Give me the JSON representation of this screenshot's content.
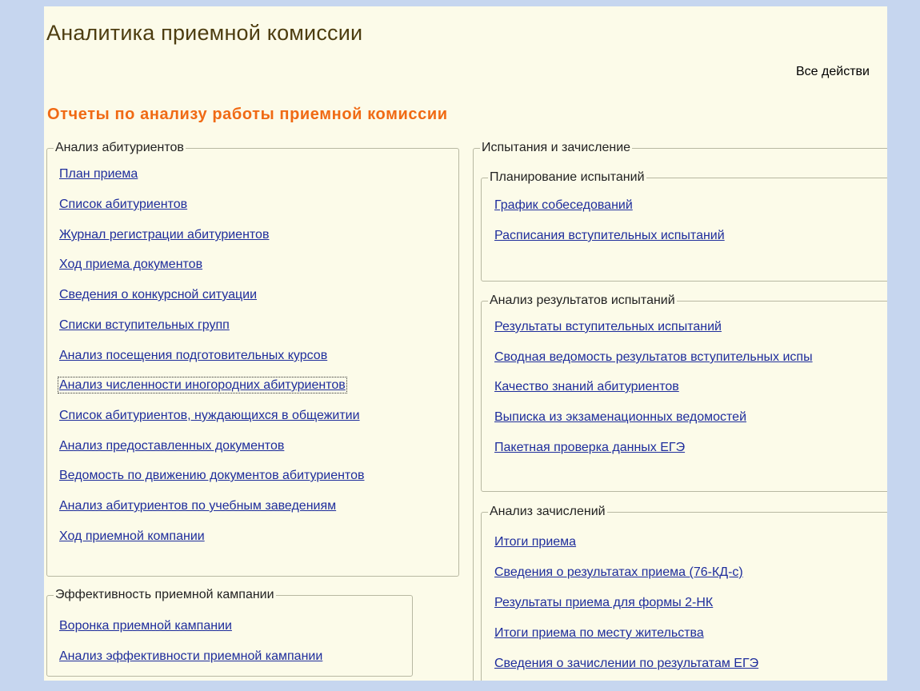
{
  "header": {
    "title": "Аналитика приемной комиссии",
    "all_actions": "Все действи"
  },
  "section_title": "Отчеты по анализу работы приемной комиссии",
  "groups": {
    "applicants": {
      "title": "Анализ абитуриентов",
      "links": [
        "План приема",
        "Список абитуриентов",
        "Журнал регистрации абитуриентов",
        "Ход приема документов",
        "Сведения о конкурсной ситуации",
        "Списки вступительных групп",
        "Анализ посещения подготовительных курсов",
        "Анализ численности иногородних абитуриентов",
        "Список абитуриентов, нуждающихся в общежитии",
        "Анализ предоставленных документов",
        "Ведомость по движению документов абитуриентов",
        "Анализ абитуриентов по учебным заведениям",
        "Ход приемной компании"
      ]
    },
    "efficiency": {
      "title": "Эффективность приемной кампании",
      "links": [
        "Воронка приемной кампании",
        "Анализ эффективности приемной кампании"
      ]
    },
    "exams": {
      "title": "Испытания и зачисление",
      "planning": {
        "title": "Планирование испытаний",
        "links": [
          "График собеседований",
          "Расписания вступительных испытаний"
        ]
      },
      "results": {
        "title": "Анализ результатов испытаний",
        "links": [
          "Результаты вступительных испытаний",
          "Сводная ведомость результатов вступительных испы",
          "Качество знаний абитуриентов",
          "Выписка из экзаменационных ведомостей",
          "Пакетная проверка данных ЕГЭ"
        ]
      },
      "enrollment": {
        "title": "Анализ зачислений",
        "links": [
          "Итоги приема",
          "Сведения о результатах приема (76-КД-с)",
          "Результаты приема для формы 2-НК",
          "Итоги приема по месту жительства",
          "Сведения о зачислении по результатам ЕГЭ"
        ]
      }
    }
  },
  "colors": {
    "frame": "#c6d6ef",
    "panel": "#fcfbe9",
    "title": "#4d3d10",
    "section": "#f06a14",
    "link": "#1e2d9c"
  }
}
